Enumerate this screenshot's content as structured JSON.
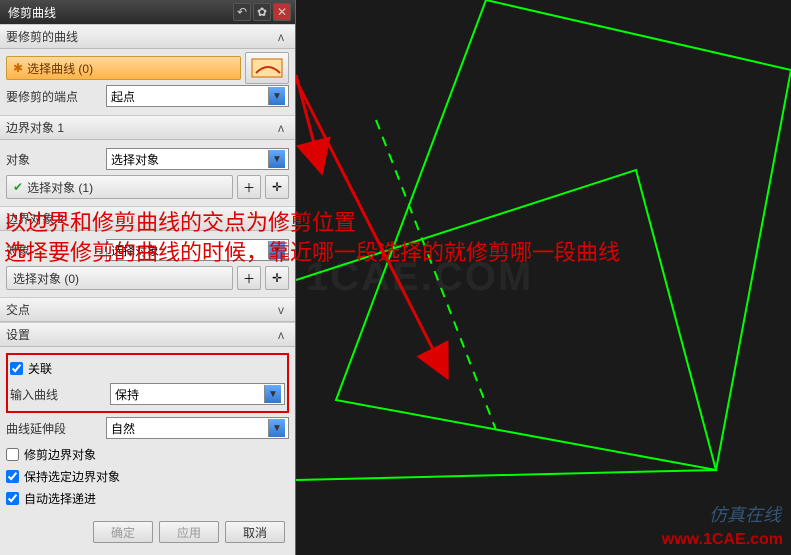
{
  "title": "修剪曲线",
  "sections": {
    "s1": {
      "title": "要修剪的曲线",
      "select_curve": "选择曲线 (0)",
      "endpoint_label": "要修剪的端点",
      "endpoint_value": "起点"
    },
    "s2": {
      "title": "边界对象 1",
      "obj_label": "对象",
      "obj_value": "选择对象",
      "select_obj": "选择对象 (1)"
    },
    "s3": {
      "title": "边界对象 2",
      "obj_label": "对象",
      "obj_value": "选择对象",
      "select_obj": "选择对象 (0)"
    },
    "s4": {
      "title": "交点"
    },
    "s5": {
      "title": "设置",
      "assoc": "关联",
      "input_curve_label": "输入曲线",
      "input_curve_value": "保持",
      "ext_label": "曲线延伸段",
      "ext_value": "自然",
      "trim_boundary": "修剪边界对象",
      "keep_boundary": "保持选定边界对象",
      "auto_select": "自动选择递进"
    }
  },
  "footer": {
    "ok": "确定",
    "apply": "应用",
    "cancel": "取消"
  },
  "overlay": {
    "line1": "以边界和修剪曲线的交点为修剪位置",
    "line2": "选择要修剪的曲线的时候，靠近哪一段选择的就修剪哪一段曲线"
  },
  "watermark": "1CAE.COM",
  "url": "www.1CAE.com",
  "logo": "仿真在线"
}
